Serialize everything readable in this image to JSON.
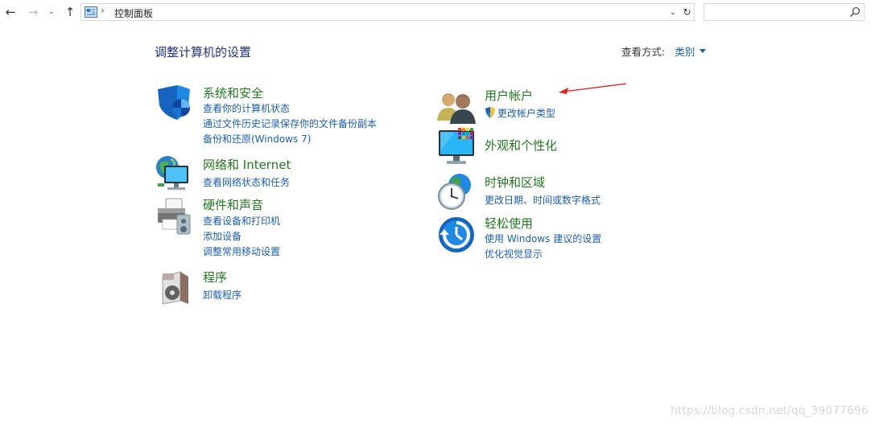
{
  "address_bar": {
    "path_label": "控制面板",
    "search_placeholder": ""
  },
  "header": {
    "title": "调整计算机的设置",
    "view_by_label": "查看方式:",
    "view_by_value": "类别"
  },
  "left_categories": [
    {
      "title": "系统和安全",
      "icon": "security-shield-icon",
      "links": [
        "查看你的计算机状态",
        "通过文件历史记录保存你的文件备份副本",
        "备份和还原(Windows 7)"
      ]
    },
    {
      "title": "网络和 Internet",
      "icon": "network-globe-icon",
      "links": [
        "查看网络状态和任务"
      ]
    },
    {
      "title": "硬件和声音",
      "icon": "printer-speaker-icon",
      "links": [
        "查看设备和打印机",
        "添加设备",
        "调整常用移动设置"
      ]
    },
    {
      "title": "程序",
      "icon": "programs-disc-icon",
      "links": [
        "卸载程序"
      ]
    }
  ],
  "right_categories": [
    {
      "title": "用户帐户",
      "icon": "user-accounts-icon",
      "links": [
        "更改帐户类型"
      ]
    },
    {
      "title": "外观和个性化",
      "icon": "appearance-monitor-icon",
      "links": []
    },
    {
      "title": "时钟和区域",
      "icon": "clock-globe-icon",
      "links": [
        "更改日期、时间或数字格式"
      ]
    },
    {
      "title": "轻松使用",
      "icon": "ease-of-access-icon",
      "links": [
        "使用 Windows 建议的设置",
        "优化视觉显示"
      ]
    }
  ],
  "watermark": "https://blog.csdn.net/qq_39077696",
  "colors": {
    "category_title": "#1f7a1f",
    "link": "#1b5eb8",
    "page_title": "#1e3287",
    "annotation_arrow": "#e0201c"
  }
}
